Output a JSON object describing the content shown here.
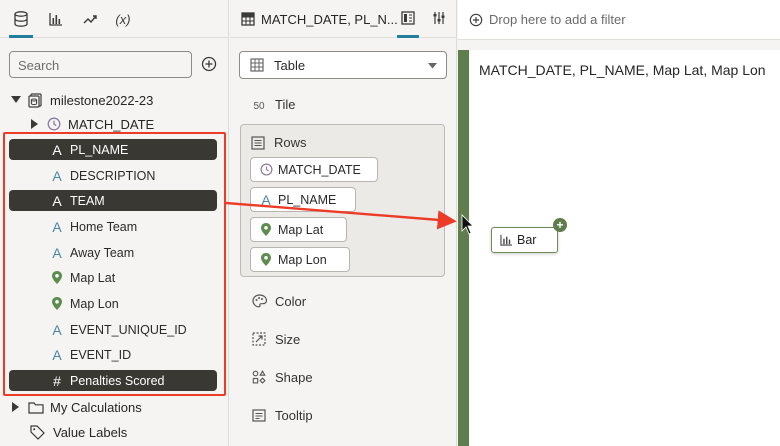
{
  "left_panel": {
    "tabs": [
      {
        "name": "data-tab",
        "label": ""
      },
      {
        "name": "visualizations-tab",
        "label": ""
      },
      {
        "name": "analytics-tab",
        "label": ""
      },
      {
        "name": "calculations-tab",
        "label": "(x)"
      }
    ],
    "search": {
      "placeholder": "Search"
    },
    "dataset": {
      "label": "milestone2022-23"
    },
    "match_date": {
      "label": "MATCH_DATE"
    },
    "fields": [
      {
        "label": "PL_NAME",
        "type": "attribute",
        "selected": true
      },
      {
        "label": "DESCRIPTION",
        "type": "attribute",
        "selected": false
      },
      {
        "label": "TEAM",
        "type": "attribute",
        "selected": true
      },
      {
        "label": "Home Team",
        "type": "attribute",
        "selected": false
      },
      {
        "label": "Away Team",
        "type": "attribute",
        "selected": false
      },
      {
        "label": "Map Lat",
        "type": "geo",
        "selected": false
      },
      {
        "label": "Map Lon",
        "type": "geo",
        "selected": false
      },
      {
        "label": "EVENT_UNIQUE_ID",
        "type": "attribute",
        "selected": false
      },
      {
        "label": "EVENT_ID",
        "type": "attribute",
        "selected": false
      },
      {
        "label": "Penalties Scored",
        "type": "measure",
        "selected": true
      }
    ],
    "my_calculations": {
      "label": "My Calculations"
    },
    "value_labels": {
      "label": "Value Labels"
    },
    "attribute_glyph": "A",
    "measure_glyph": "#"
  },
  "middle_panel": {
    "title": "MATCH_DATE, PL_N...",
    "visualization_type": "Table",
    "tile": {
      "label": "Tile",
      "icon_text": "50"
    },
    "rows": {
      "label": "Rows",
      "pills": [
        {
          "label": "MATCH_DATE",
          "type": "time"
        },
        {
          "label": "PL_NAME",
          "type": "attribute"
        },
        {
          "label": "Map Lat",
          "type": "geo"
        },
        {
          "label": "Map Lon",
          "type": "geo"
        }
      ]
    },
    "grammar": [
      {
        "label": "Color",
        "icon": "palette-icon"
      },
      {
        "label": "Size",
        "icon": "size-icon"
      },
      {
        "label": "Shape",
        "icon": "shape-icon"
      },
      {
        "label": "Tooltip",
        "icon": "tooltip-icon"
      }
    ]
  },
  "filter_bar": {
    "placeholder": "Drop here to add a filter"
  },
  "canvas": {
    "title": "MATCH_DATE, PL_NAME, Map Lat, Map Lon",
    "drag_chip": {
      "label": "Bar"
    }
  },
  "colors": {
    "selection": "#3a3833",
    "highlight": "#ec3b27",
    "drop_target": "#5f7d4d",
    "accent": "#227e9e"
  }
}
